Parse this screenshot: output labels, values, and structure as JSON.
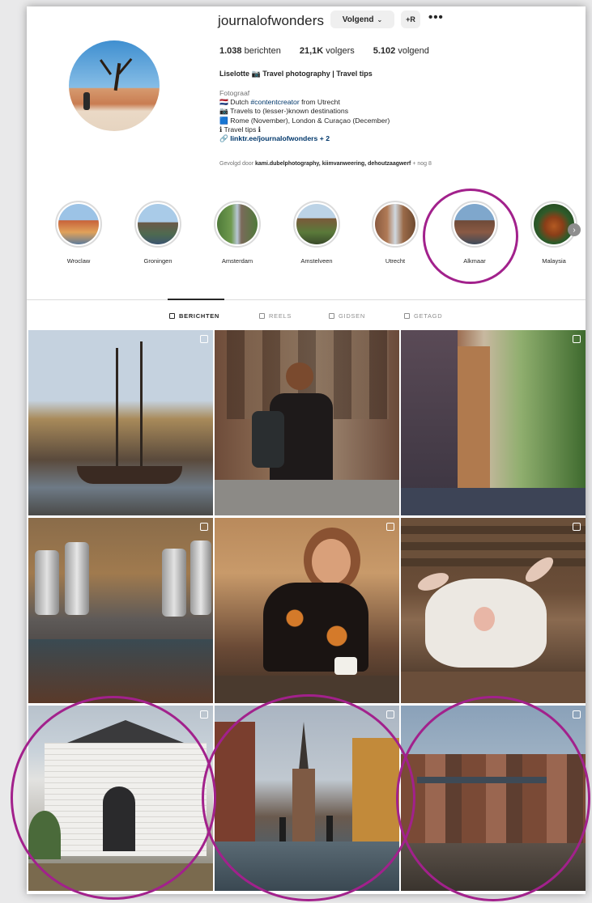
{
  "profile": {
    "username": "journalofwonders",
    "follow_label": "Volgend",
    "suggest_label": "+R",
    "more_label": "•••",
    "posts_count": "1.038",
    "posts_label": "berichten",
    "followers_count": "21,1K",
    "followers_label": "volgers",
    "following_count": "5.102",
    "following_label": "volgend",
    "full_name": "Liselotte 📷 Travel photography | Travel tips",
    "category": "Fotograaf",
    "bio_line1_prefix": "🇳🇱 Dutch ",
    "bio_line1_tag": "#contentcreator",
    "bio_line1_suffix": " from Utrecht",
    "bio_line2": "📷 Travels to (lesser-)known destinations",
    "bio_line3": "🟦 Rome (November), London & Curaçao (December)",
    "bio_line4": "ℹ Travel tips ℹ",
    "link": "🔗 linktr.ee/journalofwonders + 2",
    "followed_prefix": "Gevolgd door ",
    "followed_names": "kami.dubelphotography, kiimvanweering, dehoutzaagwerf",
    "followed_suffix": " + nog 8"
  },
  "highlights": [
    {
      "label": "Wroclaw",
      "colors": [
        "#9cc3e6",
        "#c8623a"
      ]
    },
    {
      "label": "Groningen",
      "colors": [
        "#a9cbe8",
        "#6b5a4a"
      ]
    },
    {
      "label": "Amsterdam",
      "colors": [
        "#4f7a3a",
        "#b8c7d6"
      ]
    },
    {
      "label": "Amstelveen",
      "colors": [
        "#bcd3e6",
        "#7a5a3a"
      ]
    },
    {
      "label": "Utrecht",
      "colors": [
        "#d0d8df",
        "#8a5a40"
      ]
    },
    {
      "label": "Alkmaar",
      "colors": [
        "#7fa7cc",
        "#6e4a38"
      ]
    },
    {
      "label": "Malaysia",
      "colors": [
        "#2e5b2a",
        "#b35a22"
      ]
    }
  ],
  "tabs": [
    {
      "label": "BERICHTEN",
      "active": true
    },
    {
      "label": "REELS",
      "active": false
    },
    {
      "label": "GIDSEN",
      "active": false
    },
    {
      "label": "GETAGD",
      "active": false
    }
  ],
  "posts": [
    {
      "name": "harbor-ships",
      "top": "#c5d2df",
      "bottom": "#5a4a3c",
      "badge": true
    },
    {
      "name": "woman-backpack",
      "top": "#6e4c3a",
      "bottom": "#2e2a28",
      "badge": false
    },
    {
      "name": "canal-street",
      "top": "#8fae6e",
      "bottom": "#3d4456",
      "badge": true
    },
    {
      "name": "brewery-interior",
      "top": "#8a6c4a",
      "bottom": "#2e2624",
      "badge": true
    },
    {
      "name": "woman-smiling",
      "top": "#b98a5c",
      "bottom": "#3a2c22",
      "badge": true
    },
    {
      "name": "white-goat",
      "top": "#6b4e38",
      "bottom": "#d8d4cc",
      "badge": true
    },
    {
      "name": "white-brick-house",
      "top": "#b8c2cc",
      "bottom": "#6c6a5a",
      "badge": true
    },
    {
      "name": "weigh-house-tower",
      "top": "#aab5c2",
      "bottom": "#4f5f6a",
      "badge": true
    },
    {
      "name": "canal-drawbridge",
      "top": "#8aa1b9",
      "bottom": "#4a4038",
      "badge": true
    }
  ],
  "annotation_color": "#a2218c"
}
